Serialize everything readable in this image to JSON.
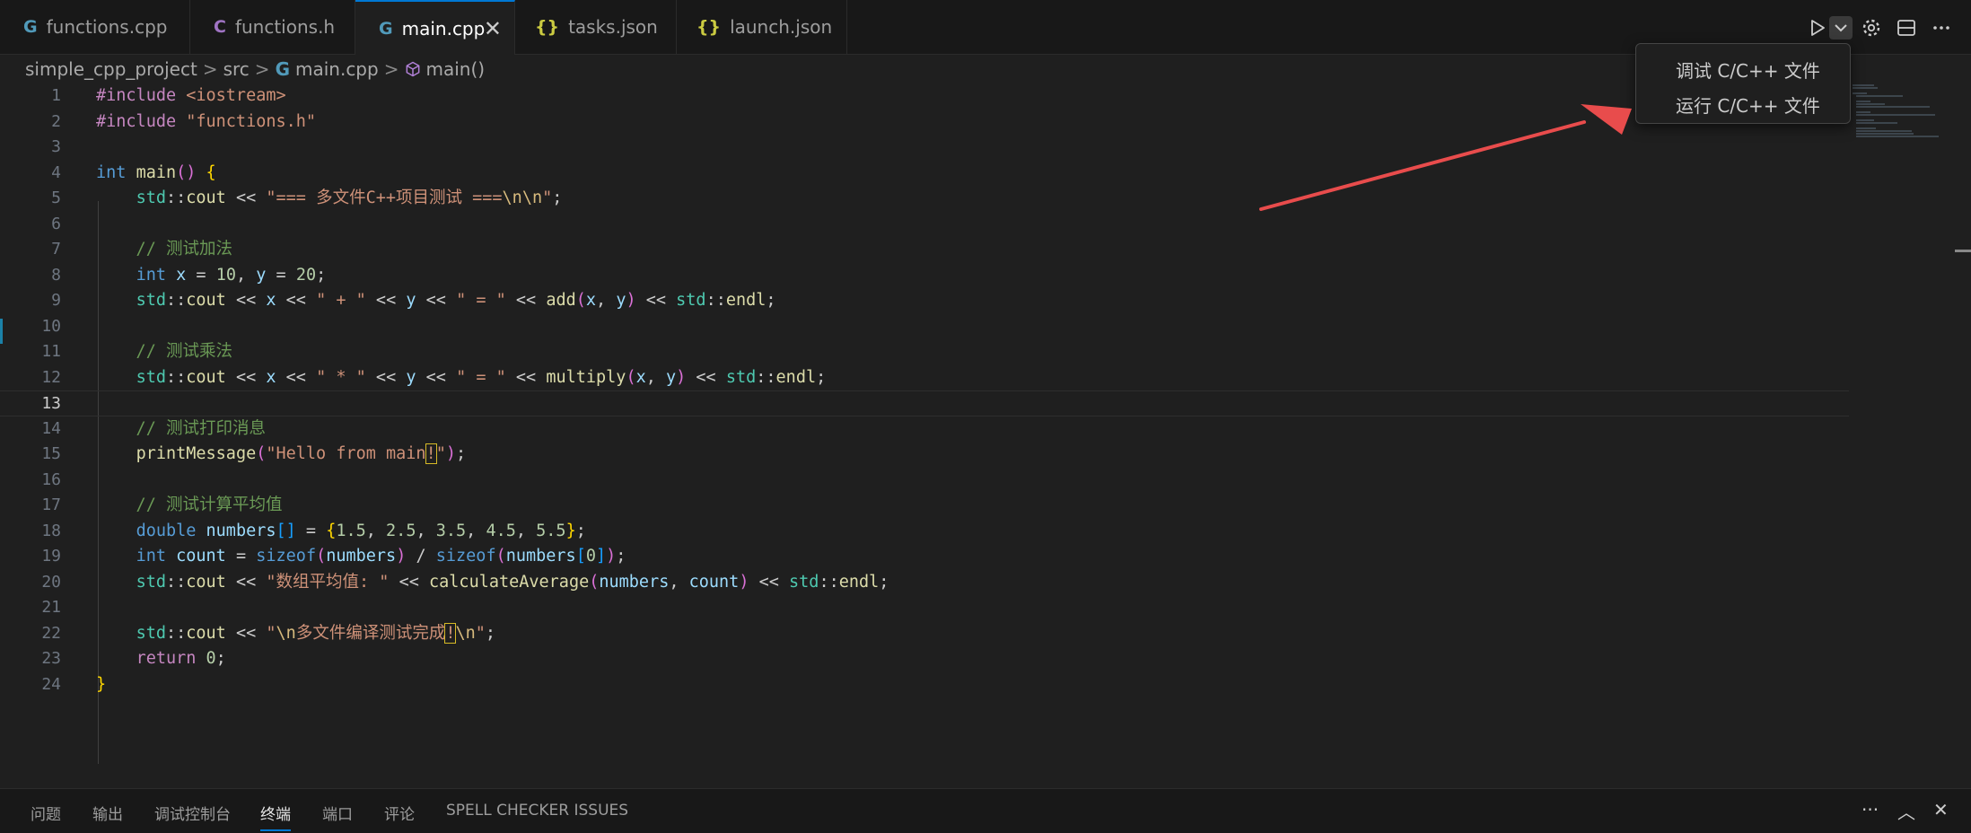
{
  "tabs": [
    {
      "label": "functions.cpp",
      "icon": "G"
    },
    {
      "label": "functions.h",
      "icon": "C"
    },
    {
      "label": "main.cpp",
      "icon": "G"
    },
    {
      "label": "tasks.json",
      "icon": "{}"
    },
    {
      "label": "launch.json",
      "icon": "{}"
    }
  ],
  "close_glyph": "✕",
  "breadcrumb": {
    "project": "simple_cpp_project",
    "folder": "src",
    "icon": "G",
    "file": "main.cpp",
    "symbol": "main()",
    "sep": ">"
  },
  "menu": {
    "items": [
      "调试 C/C++ 文件",
      "运行 C/C++ 文件"
    ]
  },
  "code_lines": [
    {
      "n": "1",
      "t": "#include <iostream>"
    },
    {
      "n": "2",
      "t": "#include \"functions.h\""
    },
    {
      "n": "3",
      "t": ""
    },
    {
      "n": "4",
      "t": "int main() {"
    },
    {
      "n": "5",
      "t": "    std::cout << \"=== 多文件C++项目测试 ===\\n\\n\";"
    },
    {
      "n": "6",
      "t": ""
    },
    {
      "n": "7",
      "t": "    // 测试加法"
    },
    {
      "n": "8",
      "t": "    int x = 10, y = 20;"
    },
    {
      "n": "9",
      "t": "    std::cout << x << \" + \" << y << \" = \" << add(x, y) << std::endl;"
    },
    {
      "n": "10",
      "t": ""
    },
    {
      "n": "11",
      "t": "    // 测试乘法"
    },
    {
      "n": "12",
      "t": "    std::cout << x << \" * \" << y << \" = \" << multiply(x, y) << std::endl;"
    },
    {
      "n": "13",
      "t": ""
    },
    {
      "n": "14",
      "t": "    // 测试打印消息"
    },
    {
      "n": "15",
      "t": "    printMessage(\"Hello from main!\");"
    },
    {
      "n": "16",
      "t": ""
    },
    {
      "n": "17",
      "t": "    // 测试计算平均值"
    },
    {
      "n": "18",
      "t": "    double numbers[] = {1.5, 2.5, 3.5, 4.5, 5.5};"
    },
    {
      "n": "19",
      "t": "    int count = sizeof(numbers) / sizeof(numbers[0]);"
    },
    {
      "n": "20",
      "t": "    std::cout << \"数组平均值: \" << calculateAverage(numbers, count) << std::endl;"
    },
    {
      "n": "21",
      "t": ""
    },
    {
      "n": "22",
      "t": "    std::cout << \"\\n多文件编译测试完成!\\n\";"
    },
    {
      "n": "23",
      "t": "    return 0;"
    },
    {
      "n": "24",
      "t": "}"
    }
  ],
  "current_line": "13",
  "panel": {
    "tabs": [
      "问题",
      "输出",
      "调试控制台",
      "终端",
      "端口",
      "评论",
      "SPELL CHECKER ISSUES"
    ],
    "active": "终端",
    "more_glyph": "···",
    "up_glyph": "︿",
    "close_glyph": "✕"
  },
  "toolbar_icons": [
    "run-icon",
    "chevron-down-icon",
    "gear-icon",
    "split-editor-icon",
    "more-icon"
  ],
  "colors": {
    "keyword": "#c586c0",
    "type": "#569cd6",
    "func": "#dcdcaa",
    "string": "#ce9178",
    "number": "#b5cea8",
    "comment": "#6a9955",
    "ns": "#4ec9b0",
    "var": "#9cdcfe",
    "arrow": "#e84c4c"
  }
}
